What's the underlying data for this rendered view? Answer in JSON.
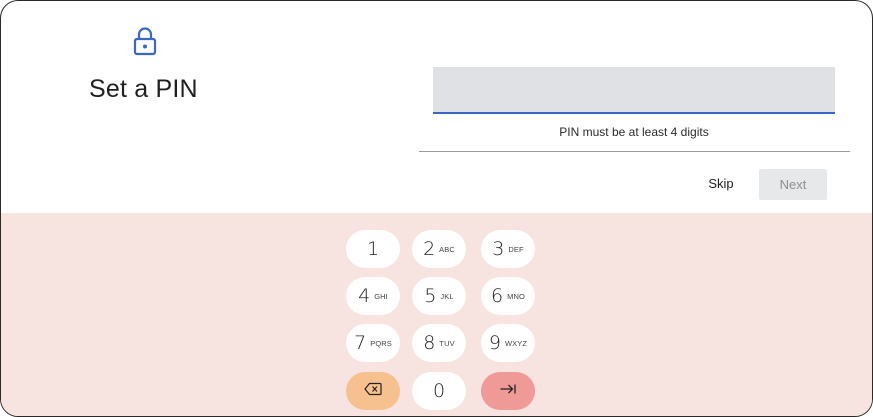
{
  "header": {
    "title": "Set a PIN",
    "icon": "lock-icon",
    "accent_color": "#3a67c2"
  },
  "pin": {
    "value": "",
    "helper": "PIN must be at least 4 digits"
  },
  "actions": {
    "skip_label": "Skip",
    "next_label": "Next"
  },
  "keypad": {
    "keys": [
      {
        "digit": "1",
        "letters": ""
      },
      {
        "digit": "2",
        "letters": "ABC"
      },
      {
        "digit": "3",
        "letters": "DEF"
      },
      {
        "digit": "4",
        "letters": "GHI"
      },
      {
        "digit": "5",
        "letters": "JKL"
      },
      {
        "digit": "6",
        "letters": "MNO"
      },
      {
        "digit": "7",
        "letters": "PQRS"
      },
      {
        "digit": "8",
        "letters": "TUV"
      },
      {
        "digit": "9",
        "letters": "WXYZ"
      },
      {
        "digit": "0",
        "letters": ""
      }
    ],
    "backspace_icon": "backspace-icon",
    "enter_icon": "enter-arrow-icon"
  }
}
